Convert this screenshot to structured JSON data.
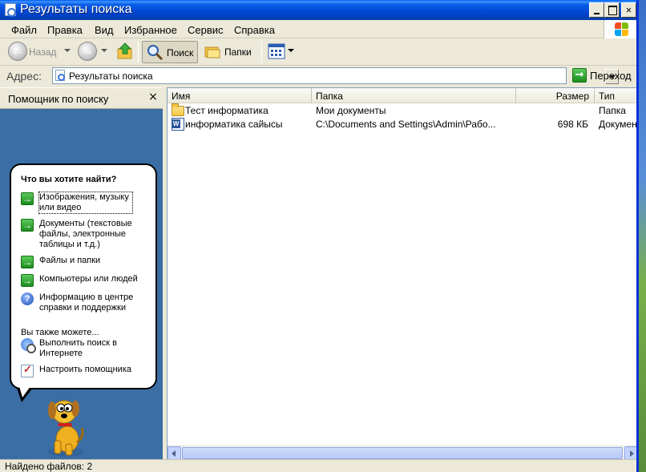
{
  "window": {
    "title": "Результаты поиска"
  },
  "menu": [
    "Файл",
    "Правка",
    "Вид",
    "Избранное",
    "Сервис",
    "Справка"
  ],
  "toolbar": {
    "back_label": "Назад",
    "search_label": "Поиск",
    "folders_label": "Папки"
  },
  "address": {
    "label": "Адрес:",
    "value": "Результаты поиска",
    "go_label": "Переход"
  },
  "pane": {
    "title": "Помощник по поиску",
    "close_glyph": "×",
    "question": "Что вы хотите найти?",
    "options": [
      "Изображения, музыку или видео",
      "Документы (текстовые файлы, электронные таблицы и т.д.)",
      "Файлы и папки",
      "Компьютеры или людей",
      "Информацию в центре справки и поддержки"
    ],
    "also": "Вы также можете...",
    "extra": [
      "Выполнить поиск в Интернете",
      "Настроить помощника"
    ]
  },
  "list": {
    "columns": [
      "Имя",
      "Папка",
      "Размер",
      "Тип"
    ],
    "rows": [
      {
        "icon": "folder-icon",
        "name": "Тест информатика",
        "folder": "Мои документы",
        "size": "",
        "type": "Папка"
      },
      {
        "icon": "word-doc-icon",
        "name": "информатика  сайысы",
        "folder": "C:\\Documents and Settings\\Admin\\Рабо...",
        "size": "698 КБ",
        "type": "Докумен"
      }
    ]
  },
  "status": {
    "text": "Найдено файлов: 2"
  },
  "colors": {
    "titlebar": "#0a5fe8",
    "pane_background": "#3a6ea5",
    "chrome": "#ece9d8"
  }
}
